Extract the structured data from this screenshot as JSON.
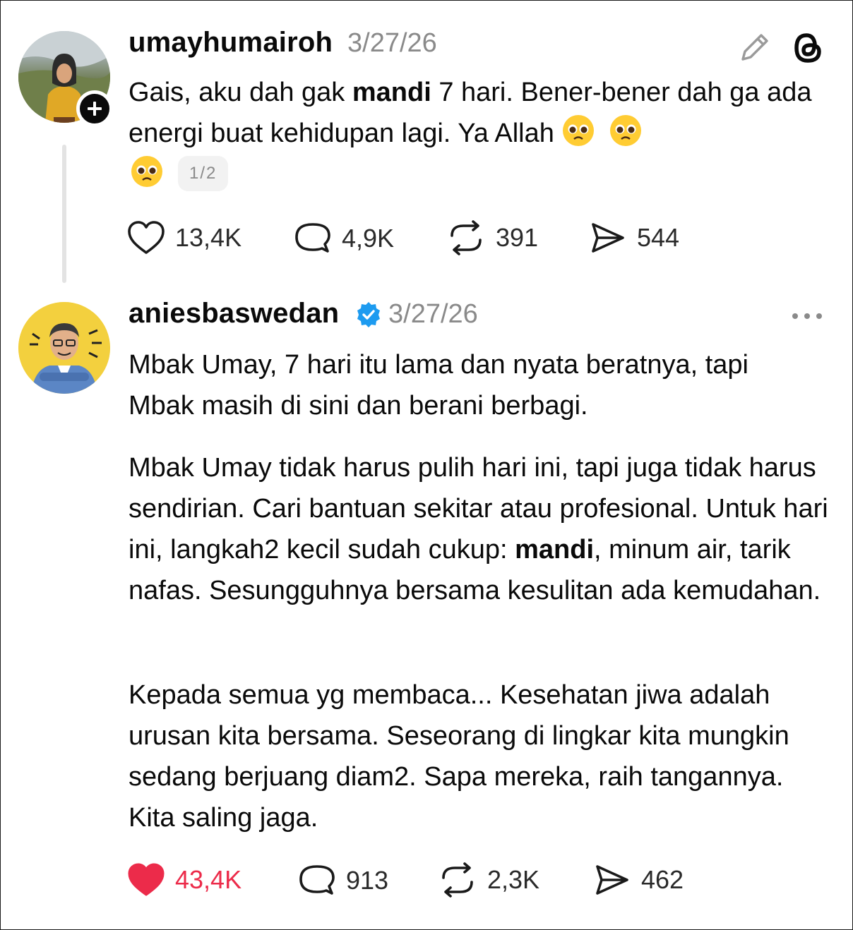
{
  "post1": {
    "username": "umayhumairoh",
    "date": "3/27/26",
    "text_parts": [
      "Gais, aku dah gak ",
      "mandi",
      " 7 hari. Bener-bener dah ga ada energi buat kehidupan lagi. Ya Allah "
    ],
    "page_indicator": "1/2",
    "stats": {
      "likes": "13,4K",
      "replies": "4,9K",
      "reposts": "391",
      "shares": "544"
    }
  },
  "post2": {
    "username": "aniesbaswedan",
    "verified": true,
    "date": "3/27/26",
    "paragraph1": "Mbak Umay, 7 hari itu lama dan nyata beratnya, tapi Mbak masih di sini dan berani berbagi.",
    "paragraph2_parts": [
      "Mbak Umay tidak harus pulih hari ini, tapi juga tidak harus sendirian. Cari bantuan sekitar atau profesional. Untuk hari ini, langkah2 kecil sudah cukup: ",
      "mandi",
      ", minum air, tarik nafas. Sesungguhnya bersama kesulitan ada kemudahan."
    ],
    "paragraph3": "Kepada semua yg membaca... Kesehatan jiwa adalah urusan kita bersama. Seseorang di lingkar kita mungkin sedang berjuang diam2. Sapa mereka, raih tangannya. Kita saling jaga.",
    "stats": {
      "likes": "43,4K",
      "replies": "913",
      "reposts": "2,3K",
      "shares": "462"
    },
    "liked": true
  },
  "icons": {
    "edit": "pencil-icon",
    "app": "threads-logo-icon",
    "more": "more-options-icon",
    "like": "heart-icon",
    "reply": "speech-bubble-icon",
    "repost": "repost-icon",
    "share": "send-icon",
    "follow": "plus-icon",
    "emoji": "pleading-face-emoji"
  },
  "colors": {
    "liked": "#ec2b4a",
    "verified": "#1d9bf0",
    "muted": "#8a8a8a"
  }
}
